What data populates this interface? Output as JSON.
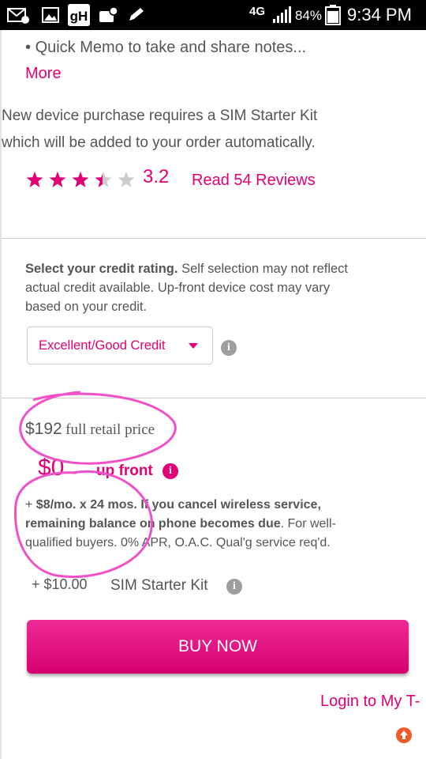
{
  "status_bar": {
    "network": "4G",
    "battery_percent": "84%",
    "time": "9:34 PM",
    "icons": [
      "gmail-icon",
      "gallery-icon",
      "gh-app-icon",
      "settings-icon",
      "pen-icon",
      "network-4g-icon",
      "signal-icon",
      "battery-icon"
    ],
    "battery_level": 0.84
  },
  "features": {
    "bullet_item": "Quick Memo to take and share notes...",
    "more_link": "More"
  },
  "sim_notice": {
    "line1": "New device purchase requires a SIM Starter Kit",
    "line2": "which will be added to your order automatically."
  },
  "rating": {
    "stars_total": 5,
    "stars_filled": 3.2,
    "value": "3.2",
    "reviews_link": "Read 54 Reviews"
  },
  "credit": {
    "heading": "Select your credit rating.",
    "text_line1_rest": "Self selection may not reflect",
    "text_line2": "actual credit available. Up-front device cost may vary",
    "text_line3": "based on your credit.",
    "select_value": "Excellent/Good Credit"
  },
  "pricing": {
    "retail_price": "$192",
    "retail_label": "full retail price",
    "upfront_price": "$0",
    "upfront_label": "up front",
    "monthly_prefix": "+ ",
    "monthly_terms": "$8/mo. x 24 mos.",
    "cancel_terms": "If you cancel wireless service,",
    "cancel_terms_line2": "remaining balance on phone becomes due",
    "fine_print_line1": ". For well-",
    "fine_print_line2": "qualified buyers. 0% APR, O.A.C. Qual'g service req'd.",
    "sim_kit_price": "+ $10.00",
    "sim_kit_label": "SIM Starter Kit"
  },
  "actions": {
    "buy_now": "BUY NOW",
    "login_link": "Login to My T-"
  },
  "colors": {
    "accent": "#e20074",
    "star_empty": "#cccccc",
    "annotation": "#f050c8"
  }
}
